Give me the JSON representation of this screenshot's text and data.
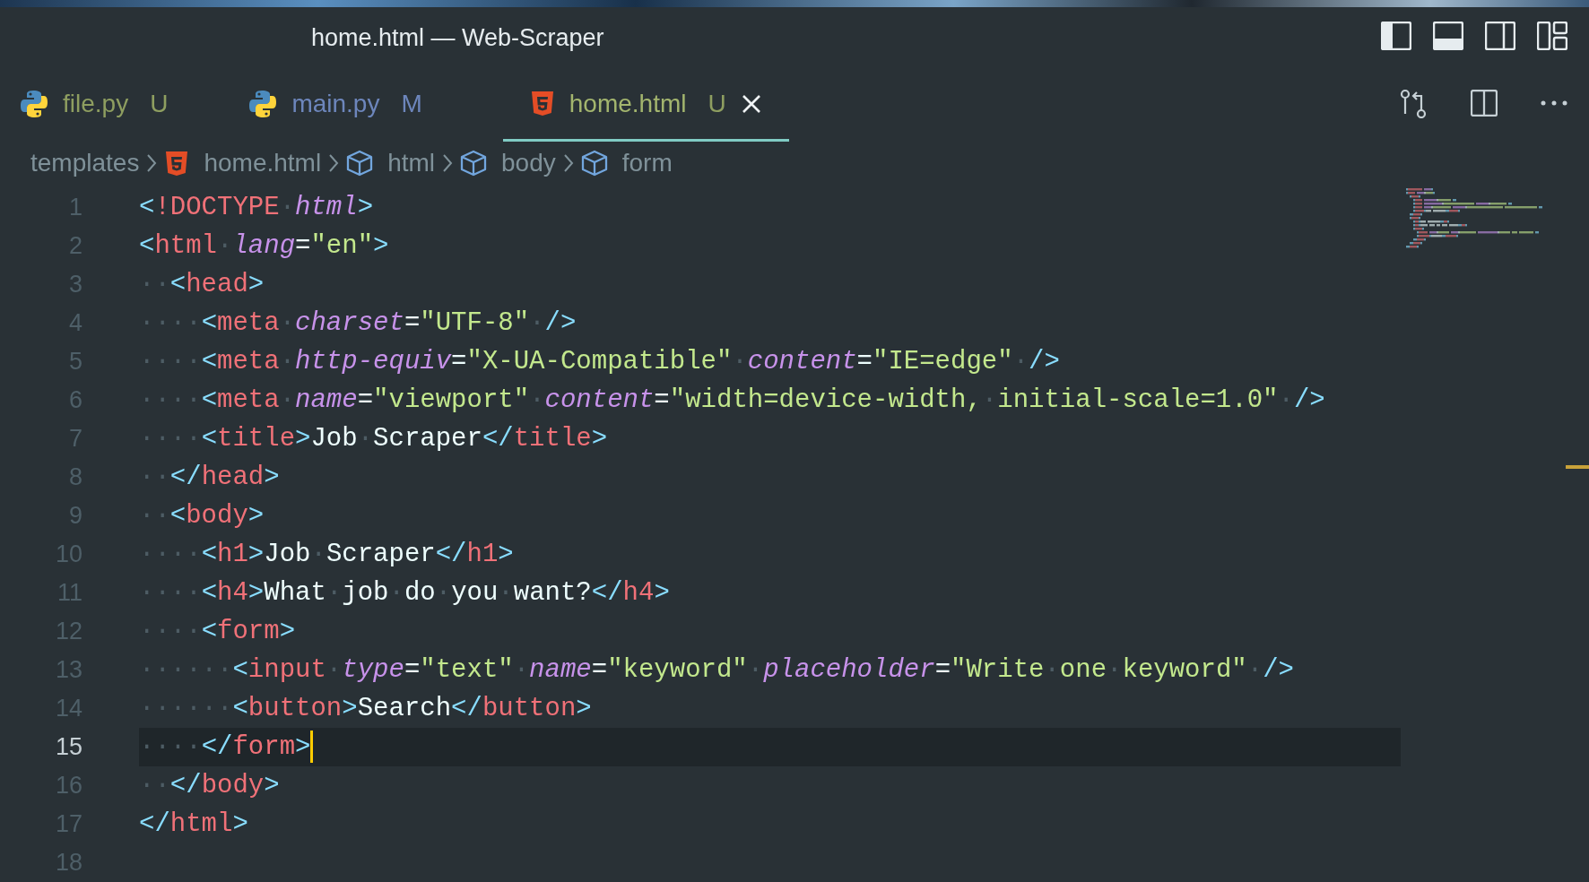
{
  "window": {
    "title": "home.html — Web-Scraper"
  },
  "tabs": [
    {
      "kind": "python",
      "label": "file.py",
      "status": "U",
      "color": "#8e9e60",
      "selected": false
    },
    {
      "kind": "python",
      "label": "main.py",
      "status": "M",
      "color": "#6d86bc",
      "selected": false
    },
    {
      "kind": "html",
      "label": "home.html",
      "status": "U",
      "color": "#8e9e60",
      "selected": true
    }
  ],
  "breadcrumbs": [
    {
      "kind": "folder",
      "label": "templates"
    },
    {
      "kind": "file",
      "label": "home.html"
    },
    {
      "kind": "element",
      "label": "html"
    },
    {
      "kind": "element",
      "label": "body"
    },
    {
      "kind": "element",
      "label": "form"
    }
  ],
  "editor": {
    "lines": [
      {
        "number": "1",
        "active": false,
        "tokens": [
          {
            "kind": "p",
            "text": "<"
          },
          {
            "kind": "tag",
            "text": "!DOCTYPE"
          },
          {
            "kind": "ws",
            "text": "·"
          },
          {
            "kind": "attr",
            "text": "html"
          },
          {
            "kind": "p",
            "text": ">"
          }
        ]
      },
      {
        "number": "2",
        "active": false,
        "tokens": [
          {
            "kind": "p",
            "text": "<"
          },
          {
            "kind": "tag",
            "text": "html"
          },
          {
            "kind": "ws",
            "text": "·"
          },
          {
            "kind": "attr",
            "text": "lang"
          },
          {
            "kind": "text",
            "text": "="
          },
          {
            "kind": "str",
            "text": "\"en\""
          },
          {
            "kind": "p",
            "text": ">"
          }
        ]
      },
      {
        "number": "3",
        "active": false,
        "tokens": [
          {
            "kind": "ws",
            "text": "··"
          },
          {
            "kind": "p",
            "text": "<"
          },
          {
            "kind": "tag",
            "text": "head"
          },
          {
            "kind": "p",
            "text": ">"
          }
        ]
      },
      {
        "number": "4",
        "active": false,
        "tokens": [
          {
            "kind": "ws",
            "text": "····"
          },
          {
            "kind": "p",
            "text": "<"
          },
          {
            "kind": "tag",
            "text": "meta"
          },
          {
            "kind": "ws",
            "text": "·"
          },
          {
            "kind": "attr",
            "text": "charset"
          },
          {
            "kind": "text",
            "text": "="
          },
          {
            "kind": "str",
            "text": "\"UTF-8\""
          },
          {
            "kind": "ws",
            "text": "·"
          },
          {
            "kind": "p",
            "text": "/>"
          }
        ]
      },
      {
        "number": "5",
        "active": false,
        "tokens": [
          {
            "kind": "ws",
            "text": "····"
          },
          {
            "kind": "p",
            "text": "<"
          },
          {
            "kind": "tag",
            "text": "meta"
          },
          {
            "kind": "ws",
            "text": "·"
          },
          {
            "kind": "attr",
            "text": "http-equiv"
          },
          {
            "kind": "text",
            "text": "="
          },
          {
            "kind": "str",
            "text": "\"X-UA-Compatible\""
          },
          {
            "kind": "ws",
            "text": "·"
          },
          {
            "kind": "attr",
            "text": "content"
          },
          {
            "kind": "text",
            "text": "="
          },
          {
            "kind": "str",
            "text": "\"IE=edge\""
          },
          {
            "kind": "ws",
            "text": "·"
          },
          {
            "kind": "p",
            "text": "/>"
          }
        ]
      },
      {
        "number": "6",
        "active": false,
        "tokens": [
          {
            "kind": "ws",
            "text": "····"
          },
          {
            "kind": "p",
            "text": "<"
          },
          {
            "kind": "tag",
            "text": "meta"
          },
          {
            "kind": "ws",
            "text": "·"
          },
          {
            "kind": "attr",
            "text": "name"
          },
          {
            "kind": "text",
            "text": "="
          },
          {
            "kind": "str",
            "text": "\"viewport\""
          },
          {
            "kind": "ws",
            "text": "·"
          },
          {
            "kind": "attr",
            "text": "content"
          },
          {
            "kind": "text",
            "text": "="
          },
          {
            "kind": "str",
            "text": "\"width=device-width,"
          },
          {
            "kind": "ws",
            "text": "·"
          },
          {
            "kind": "str",
            "text": "initial-scale=1.0\""
          },
          {
            "kind": "ws",
            "text": "·"
          },
          {
            "kind": "p",
            "text": "/>"
          }
        ]
      },
      {
        "number": "7",
        "active": false,
        "tokens": [
          {
            "kind": "ws",
            "text": "····"
          },
          {
            "kind": "p",
            "text": "<"
          },
          {
            "kind": "tag",
            "text": "title"
          },
          {
            "kind": "p",
            "text": ">"
          },
          {
            "kind": "text",
            "text": "Job"
          },
          {
            "kind": "ws",
            "text": "·"
          },
          {
            "kind": "text",
            "text": "Scraper"
          },
          {
            "kind": "p",
            "text": "</"
          },
          {
            "kind": "tag",
            "text": "title"
          },
          {
            "kind": "p",
            "text": ">"
          }
        ]
      },
      {
        "number": "8",
        "active": false,
        "tokens": [
          {
            "kind": "ws",
            "text": "··"
          },
          {
            "kind": "p",
            "text": "</"
          },
          {
            "kind": "tag",
            "text": "head"
          },
          {
            "kind": "p",
            "text": ">"
          }
        ]
      },
      {
        "number": "9",
        "active": false,
        "tokens": [
          {
            "kind": "ws",
            "text": "··"
          },
          {
            "kind": "p",
            "text": "<"
          },
          {
            "kind": "tag",
            "text": "body"
          },
          {
            "kind": "p",
            "text": ">"
          }
        ]
      },
      {
        "number": "10",
        "active": false,
        "tokens": [
          {
            "kind": "ws",
            "text": "····"
          },
          {
            "kind": "p",
            "text": "<"
          },
          {
            "kind": "tag",
            "text": "h1"
          },
          {
            "kind": "p",
            "text": ">"
          },
          {
            "kind": "text",
            "text": "Job"
          },
          {
            "kind": "ws",
            "text": "·"
          },
          {
            "kind": "text",
            "text": "Scraper"
          },
          {
            "kind": "p",
            "text": "</"
          },
          {
            "kind": "tag",
            "text": "h1"
          },
          {
            "kind": "p",
            "text": ">"
          }
        ]
      },
      {
        "number": "11",
        "active": false,
        "tokens": [
          {
            "kind": "ws",
            "text": "····"
          },
          {
            "kind": "p",
            "text": "<"
          },
          {
            "kind": "tag",
            "text": "h4"
          },
          {
            "kind": "p",
            "text": ">"
          },
          {
            "kind": "text",
            "text": "What"
          },
          {
            "kind": "ws",
            "text": "·"
          },
          {
            "kind": "text",
            "text": "job"
          },
          {
            "kind": "ws",
            "text": "·"
          },
          {
            "kind": "text",
            "text": "do"
          },
          {
            "kind": "ws",
            "text": "·"
          },
          {
            "kind": "text",
            "text": "you"
          },
          {
            "kind": "ws",
            "text": "·"
          },
          {
            "kind": "text",
            "text": "want?"
          },
          {
            "kind": "p",
            "text": "</"
          },
          {
            "kind": "tag",
            "text": "h4"
          },
          {
            "kind": "p",
            "text": ">"
          }
        ]
      },
      {
        "number": "12",
        "active": false,
        "tokens": [
          {
            "kind": "ws",
            "text": "····"
          },
          {
            "kind": "p",
            "text": "<"
          },
          {
            "kind": "tag",
            "text": "form"
          },
          {
            "kind": "p",
            "text": ">"
          }
        ]
      },
      {
        "number": "13",
        "active": false,
        "tokens": [
          {
            "kind": "ws",
            "text": "······"
          },
          {
            "kind": "p",
            "text": "<"
          },
          {
            "kind": "tag",
            "text": "input"
          },
          {
            "kind": "ws",
            "text": "·"
          },
          {
            "kind": "attr",
            "text": "type"
          },
          {
            "kind": "text",
            "text": "="
          },
          {
            "kind": "str",
            "text": "\"text\""
          },
          {
            "kind": "ws",
            "text": "·"
          },
          {
            "kind": "attr",
            "text": "name"
          },
          {
            "kind": "text",
            "text": "="
          },
          {
            "kind": "str",
            "text": "\"keyword\""
          },
          {
            "kind": "ws",
            "text": "·"
          },
          {
            "kind": "attr",
            "text": "placeholder"
          },
          {
            "kind": "text",
            "text": "="
          },
          {
            "kind": "str",
            "text": "\"Write"
          },
          {
            "kind": "ws",
            "text": "·"
          },
          {
            "kind": "str",
            "text": "one"
          },
          {
            "kind": "ws",
            "text": "·"
          },
          {
            "kind": "str",
            "text": "keyword\""
          },
          {
            "kind": "ws",
            "text": "·"
          },
          {
            "kind": "p",
            "text": "/>"
          }
        ]
      },
      {
        "number": "14",
        "active": false,
        "tokens": [
          {
            "kind": "ws",
            "text": "······"
          },
          {
            "kind": "p",
            "text": "<"
          },
          {
            "kind": "tag",
            "text": "button"
          },
          {
            "kind": "p",
            "text": ">"
          },
          {
            "kind": "text",
            "text": "Search"
          },
          {
            "kind": "p",
            "text": "</"
          },
          {
            "kind": "tag",
            "text": "button"
          },
          {
            "kind": "p",
            "text": ">"
          }
        ]
      },
      {
        "number": "15",
        "active": true,
        "tokens": [
          {
            "kind": "ws",
            "text": "····"
          },
          {
            "kind": "p",
            "text": "</"
          },
          {
            "kind": "tag",
            "text": "form"
          },
          {
            "kind": "p",
            "text": ">"
          }
        ]
      },
      {
        "number": "16",
        "active": false,
        "tokens": [
          {
            "kind": "ws",
            "text": "··"
          },
          {
            "kind": "p",
            "text": "</"
          },
          {
            "kind": "tag",
            "text": "body"
          },
          {
            "kind": "p",
            "text": ">"
          }
        ]
      },
      {
        "number": "17",
        "active": false,
        "tokens": [
          {
            "kind": "p",
            "text": "</"
          },
          {
            "kind": "tag",
            "text": "html"
          },
          {
            "kind": "p",
            "text": ">"
          }
        ]
      },
      {
        "number": "18",
        "active": false
      }
    ]
  }
}
